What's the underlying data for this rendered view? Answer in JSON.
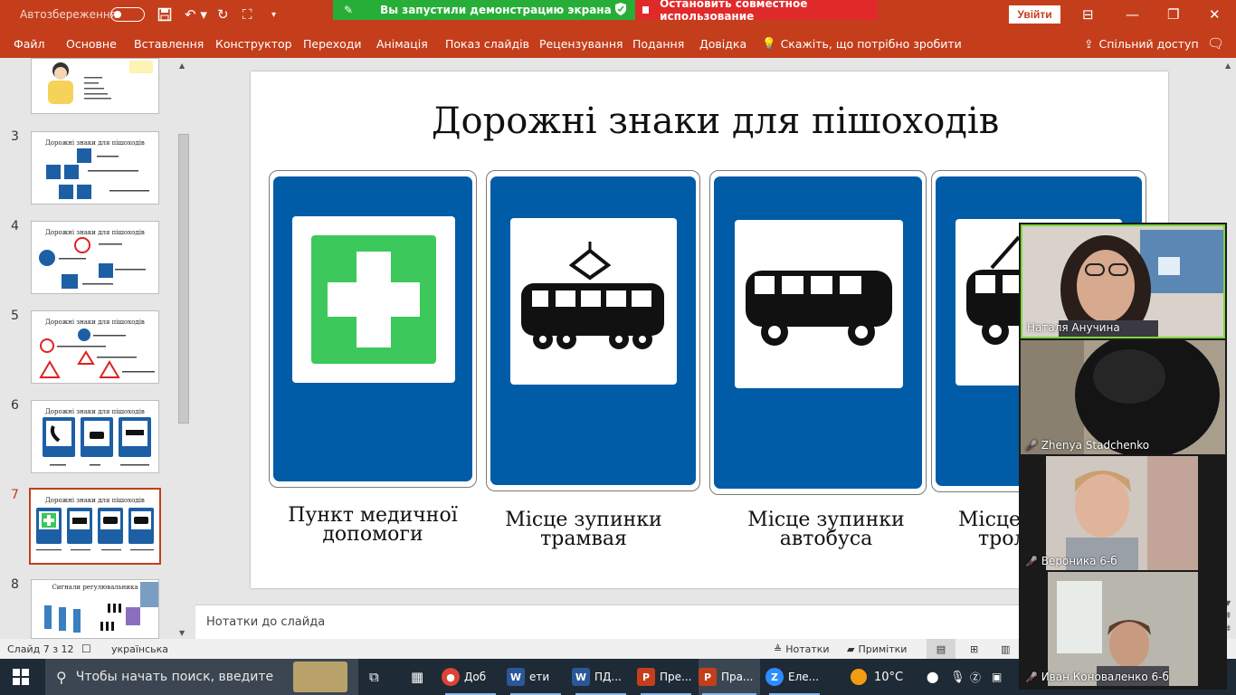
{
  "titlebar": {
    "autosave_label": "Автозбереження",
    "sharing_notice": "Вы запустили демонстрацию экрана",
    "stop_sharing": "Остановить совместное использование",
    "sign_in": "Увійти"
  },
  "menu": {
    "items": [
      "Файл",
      "Основне",
      "Вставлення",
      "Конструктор",
      "Переходи",
      "Анімація",
      "Показ слайдів",
      "Рецензування",
      "Подання",
      "Довідка"
    ],
    "tell_me": "Скажіть, що потрібно зробити",
    "share": "Спільний доступ"
  },
  "thumbnails": [
    {
      "num": "",
      "title": ""
    },
    {
      "num": "3",
      "title": "Дорожні знаки для пішоходів"
    },
    {
      "num": "4",
      "title": "Дорожні знаки для пішоходів"
    },
    {
      "num": "5",
      "title": "Дорожні знаки для пішоходів"
    },
    {
      "num": "6",
      "title": "Дорожні знаки для пішоходів"
    },
    {
      "num": "7",
      "title": "Дорожні знаки для пішоходів"
    },
    {
      "num": "8",
      "title": "Сигнали регулювальника"
    }
  ],
  "slide": {
    "title": "Дорожні знаки для пішоходів",
    "captions": [
      {
        "line1": "Пункт медичної",
        "line2": "допомоги"
      },
      {
        "line1": "Місце зупинки",
        "line2": "трамвая"
      },
      {
        "line1": "Місце зупинки",
        "line2": "автобуса"
      },
      {
        "line1": "Місце",
        "line2": "трол"
      }
    ]
  },
  "notes_placeholder": "Нотатки до слайда",
  "status": {
    "slide_counter": "Слайд 7 з 12",
    "language": "українська",
    "notes": "Нотатки",
    "comments": "Примітки"
  },
  "taskbar": {
    "search_placeholder": "Чтобы начать поиск, введите",
    "apps": [
      "Доб",
      "ети",
      "ПД...",
      "Пре...",
      "Пра...",
      "Еле..."
    ],
    "temperature": "10°C"
  },
  "participants": [
    {
      "name": "Наталя Анучина"
    },
    {
      "name": "Zhenya Stadchenko"
    },
    {
      "name": "Вероника 6-б"
    },
    {
      "name": "Иван Коноваленко 6-б"
    }
  ],
  "colors": {
    "accent": "#c43e1c",
    "sign_blue": "#005ca7",
    "medical_green": "#3cc85a"
  }
}
